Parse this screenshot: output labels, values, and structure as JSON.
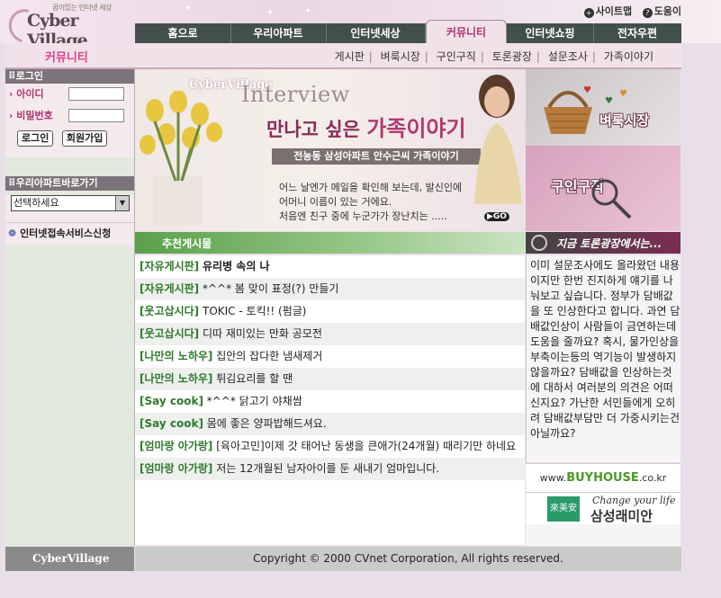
{
  "header": {
    "logo_tagline": "꿈이있는 인터넷 세상",
    "logo_name": "Cyber Village",
    "sitemap": "사이트맵",
    "help": "도움이"
  },
  "nav": {
    "tabs": [
      "홈으로",
      "우리아파트",
      "인터넷세상",
      "커뮤니티",
      "인터넷쇼핑",
      "전자우편"
    ],
    "active": "커뮤니티"
  },
  "subnav": {
    "section_title": "커뮤니티",
    "links": [
      "게시판",
      "벼룩시장",
      "구인구직",
      "토론광장",
      "설문조사",
      "가족이야기"
    ]
  },
  "login": {
    "title": "로그인",
    "id_label": "아이디",
    "pw_label": "비밀번호",
    "login_btn": "로그인",
    "join_btn": "회원가입"
  },
  "apt": {
    "title": "우리아파트바로가기",
    "select_value": "선택하세요"
  },
  "service_link": "인터넷접속서비스신청",
  "banner": {
    "brand": "CyberVillage",
    "interview": "Interview",
    "headline_a": "만나고 싶은",
    "headline_b": "가족이야기",
    "subtitle": "전농동 삼성아파트 안수근씨 가족이야기",
    "para1": "어느 날엔가 메일을 확인해 보는데, 발신인에",
    "para2": "어머니 이름이 있는 거에요.",
    "para3": "처음엔 친구 중에 누군가가 장난치는 .....",
    "go": "GO"
  },
  "ads": {
    "flea": "벼룩시장",
    "jobs": "구인구직"
  },
  "list": {
    "title": "추천게시물",
    "items": [
      {
        "cat": "[자유게시판]",
        "text": "유리병 속의 나"
      },
      {
        "cat": "[자유게시판]",
        "text": "*^^* 봄 맞이 표정(?) 만들기"
      },
      {
        "cat": "[웃고삽시다]",
        "text": "TOKIC - 토킥!! (펌글)"
      },
      {
        "cat": "[웃고삽시다]",
        "text": "디따 재미있는 만화 공모전"
      },
      {
        "cat": "[나만의 노하우]",
        "text": "집안의 잡다한 냄새제거"
      },
      {
        "cat": "[나만의 노하우]",
        "text": "튀김요리를 할 땐"
      },
      {
        "cat": "[Say cook]",
        "text": "*^^* 닭고기 야채쌈"
      },
      {
        "cat": "[Say cook]",
        "text": "몸에 좋은 양파밥해드셔요."
      },
      {
        "cat": "[엄마랑 아가랑]",
        "text": "[육아고민]이제 갓 태어난 동생을 큰애가(24개월) 때리기만 하네요"
      },
      {
        "cat": "[엄마랑 아가랑]",
        "text": "저는 12개월된 남자아이를 둔 새내기 엄마입니다."
      }
    ]
  },
  "debate": {
    "title": "지금 토론광장에서는...",
    "text": "이미 설문조사에도 올라왔던 내용이지만 한번 진지하게 얘기를 나눠보고 싶습니다. 정부가 담배값을 또 인상한다고 합니다. 과연 담배값인상이 사람들이 금연하는데 도움을 줄까요? 혹시, 물가인상을 부축이는등의 역기능이 발생하지 않을까요? 담배값을 인상하는것에 대하서 여러분의 의견은 어떠신지요? 가난한 서민들에게 오히려 담배값부담만 더 가중시키는건 아닐까요?"
  },
  "partners": {
    "buyhouse_pre": "www.",
    "buyhouse_name": "BUYHOUSE",
    "buyhouse_post": ".co.kr",
    "raemian_box": "來美安",
    "raemian_tagline": "Change your life",
    "raemian_name": "삼성래미안"
  },
  "footer": {
    "logo": "CyberVillage",
    "copyright": "Copyright © 2000 CVnet Corporation, All rights reserved."
  },
  "colors": {
    "accent": "#b2306c",
    "nav": "#42504c",
    "list_green": "#2f7a2c"
  }
}
